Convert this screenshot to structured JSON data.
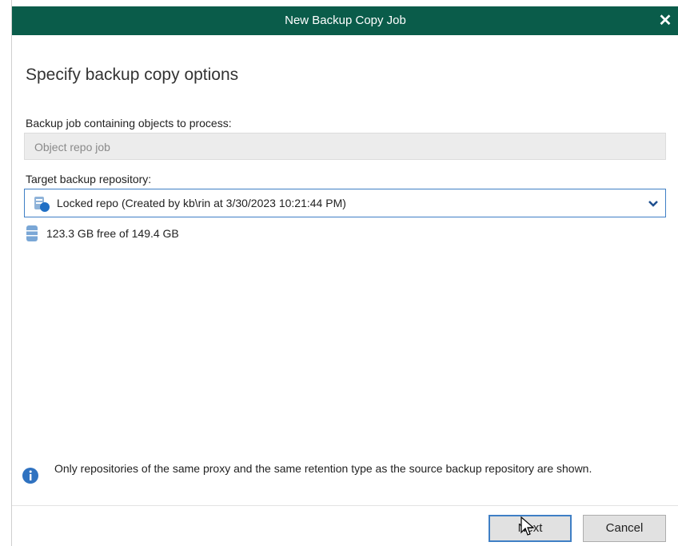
{
  "window": {
    "title": "New Backup Copy Job",
    "close_label": "✕"
  },
  "page": {
    "heading": "Specify backup copy options"
  },
  "backup_job": {
    "label": "Backup job containing objects to process:",
    "value": "Object repo job"
  },
  "target_repo": {
    "label": "Target backup repository:",
    "selected": "Locked repo (Created by kb\\rin at 3/30/2023 10:21:44 PM)",
    "free_space": "123.3 GB free of 149.4 GB"
  },
  "info": {
    "message": "Only repositories of the same proxy and the same retention type as the source backup repository are shown."
  },
  "buttons": {
    "next": "Next",
    "cancel": "Cancel"
  },
  "colors": {
    "titlebar": "#0a5c4a",
    "accent": "#3f7fc5"
  },
  "icons": {
    "repo": "repository-icon",
    "db": "database-icon",
    "info": "info-icon",
    "chevron": "chevron-down-icon"
  }
}
